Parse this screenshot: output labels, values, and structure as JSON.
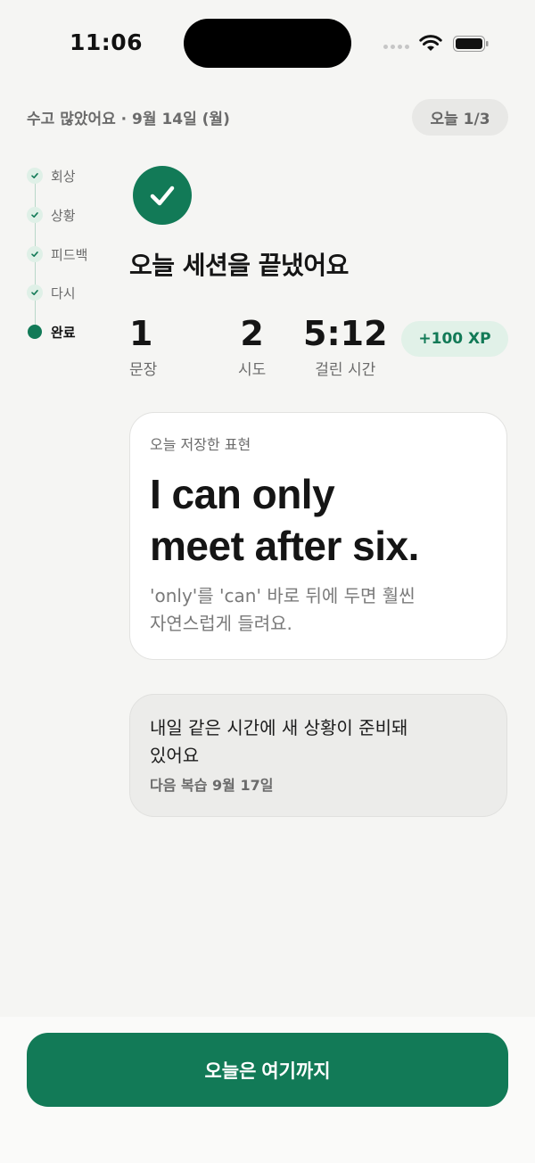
{
  "status_bar": {
    "time": "11:06"
  },
  "header": {
    "subtitle": "수고 많았어요 · 9월 14일 (월)",
    "progress": "오늘 1/3"
  },
  "stepper": {
    "steps": [
      {
        "label": "회상",
        "state": "done"
      },
      {
        "label": "상황",
        "state": "done"
      },
      {
        "label": "피드백",
        "state": "done"
      },
      {
        "label": "다시",
        "state": "done"
      },
      {
        "label": "완료",
        "state": "active"
      }
    ]
  },
  "summary": {
    "title": "오늘 세션을 끝냈어요",
    "stats": [
      {
        "value": "1",
        "label": "문장"
      },
      {
        "value": "2",
        "label": "시도"
      },
      {
        "value": "5:12",
        "label": "걸린 시간"
      }
    ],
    "xp": "+100 XP"
  },
  "saved_phrase": {
    "kicker": "오늘 저장한 표현",
    "phrase_line1": "I can only",
    "phrase_line2": "meet after six.",
    "note_line1": "'only'를 'can' 바로 뒤에 두면 훨씬",
    "note_line2": "자연스럽게 들려요."
  },
  "next_session": {
    "title_line1": "내일 같은 시간에 새 상황이 준비돼",
    "title_line2": "있어요",
    "sub": "다음 복습 9월 17일"
  },
  "footer": {
    "finish_label": "오늘은 여기까지"
  },
  "colors": {
    "accent": "#127a57",
    "accent_soft": "#e1f1e8",
    "background": "#f5f5f3"
  },
  "icons": [
    "check-icon",
    "wifi-icon",
    "battery-icon",
    "signal-icon"
  ]
}
